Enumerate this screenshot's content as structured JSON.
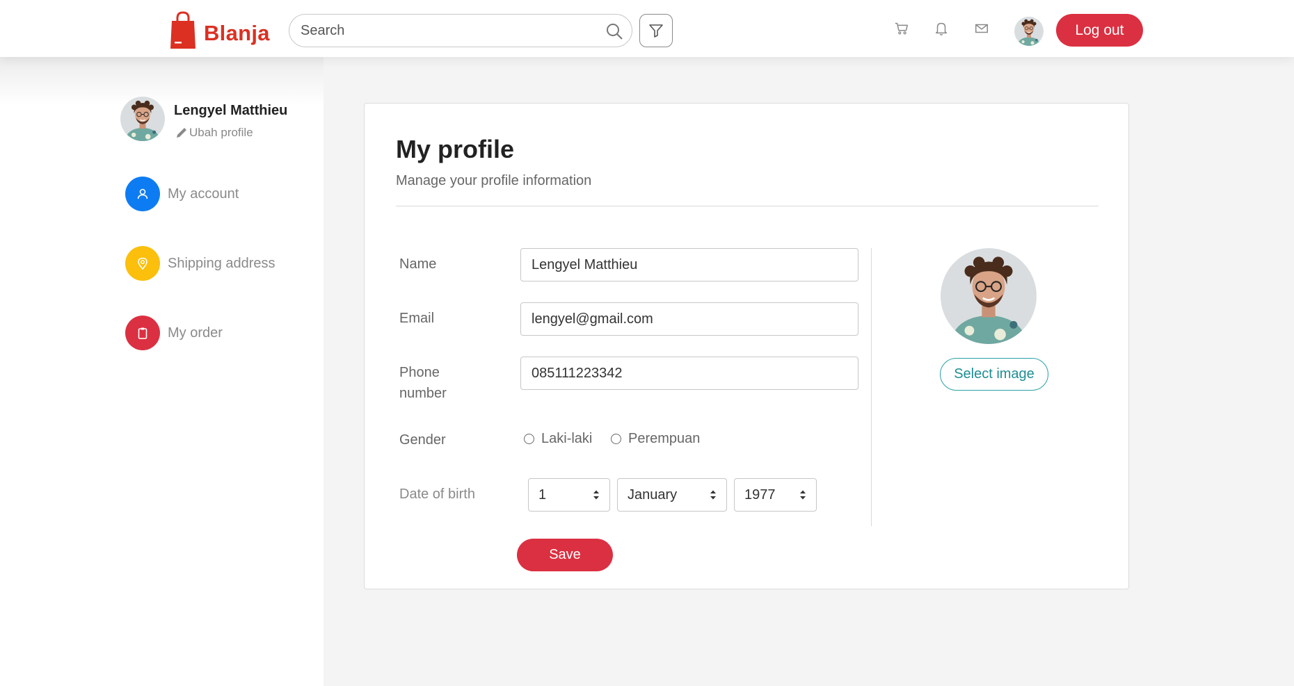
{
  "header": {
    "brand": "Blanja",
    "search_placeholder": "Search",
    "logout_label": "Log out",
    "icons": [
      "shopping-bag-icon",
      "search-icon",
      "filter-icon",
      "cart-icon",
      "bell-icon",
      "mail-icon"
    ]
  },
  "sidebar": {
    "user_name": "Lengyel Matthieu",
    "edit_label": "Ubah profile",
    "items": [
      {
        "label": "My account",
        "icon": "user-icon",
        "color": "#0d7cf2"
      },
      {
        "label": "Shipping address",
        "icon": "location-pin-icon",
        "color": "#fbbf0c"
      },
      {
        "label": "My order",
        "icon": "clipboard-icon",
        "color": "#db3041"
      }
    ]
  },
  "profile": {
    "title": "My profile",
    "subtitle": "Manage your profile information",
    "fields": {
      "name_label": "Name",
      "name_value": "Lengyel Matthieu",
      "email_label": "Email",
      "email_value": "lengyel@gmail.com",
      "phone_label": "Phone number",
      "phone_value": "085111223342",
      "gender_label": "Gender",
      "gender_options": [
        "Laki-laki",
        "Perempuan"
      ],
      "dob_label": "Date of birth",
      "dob_day": "1",
      "dob_month": "January",
      "dob_year": "1977"
    },
    "select_image_label": "Select image",
    "save_label": "Save"
  },
  "colors": {
    "brand_red": "#db3022",
    "button_red": "#db3041",
    "teal": "#29a0a6"
  }
}
